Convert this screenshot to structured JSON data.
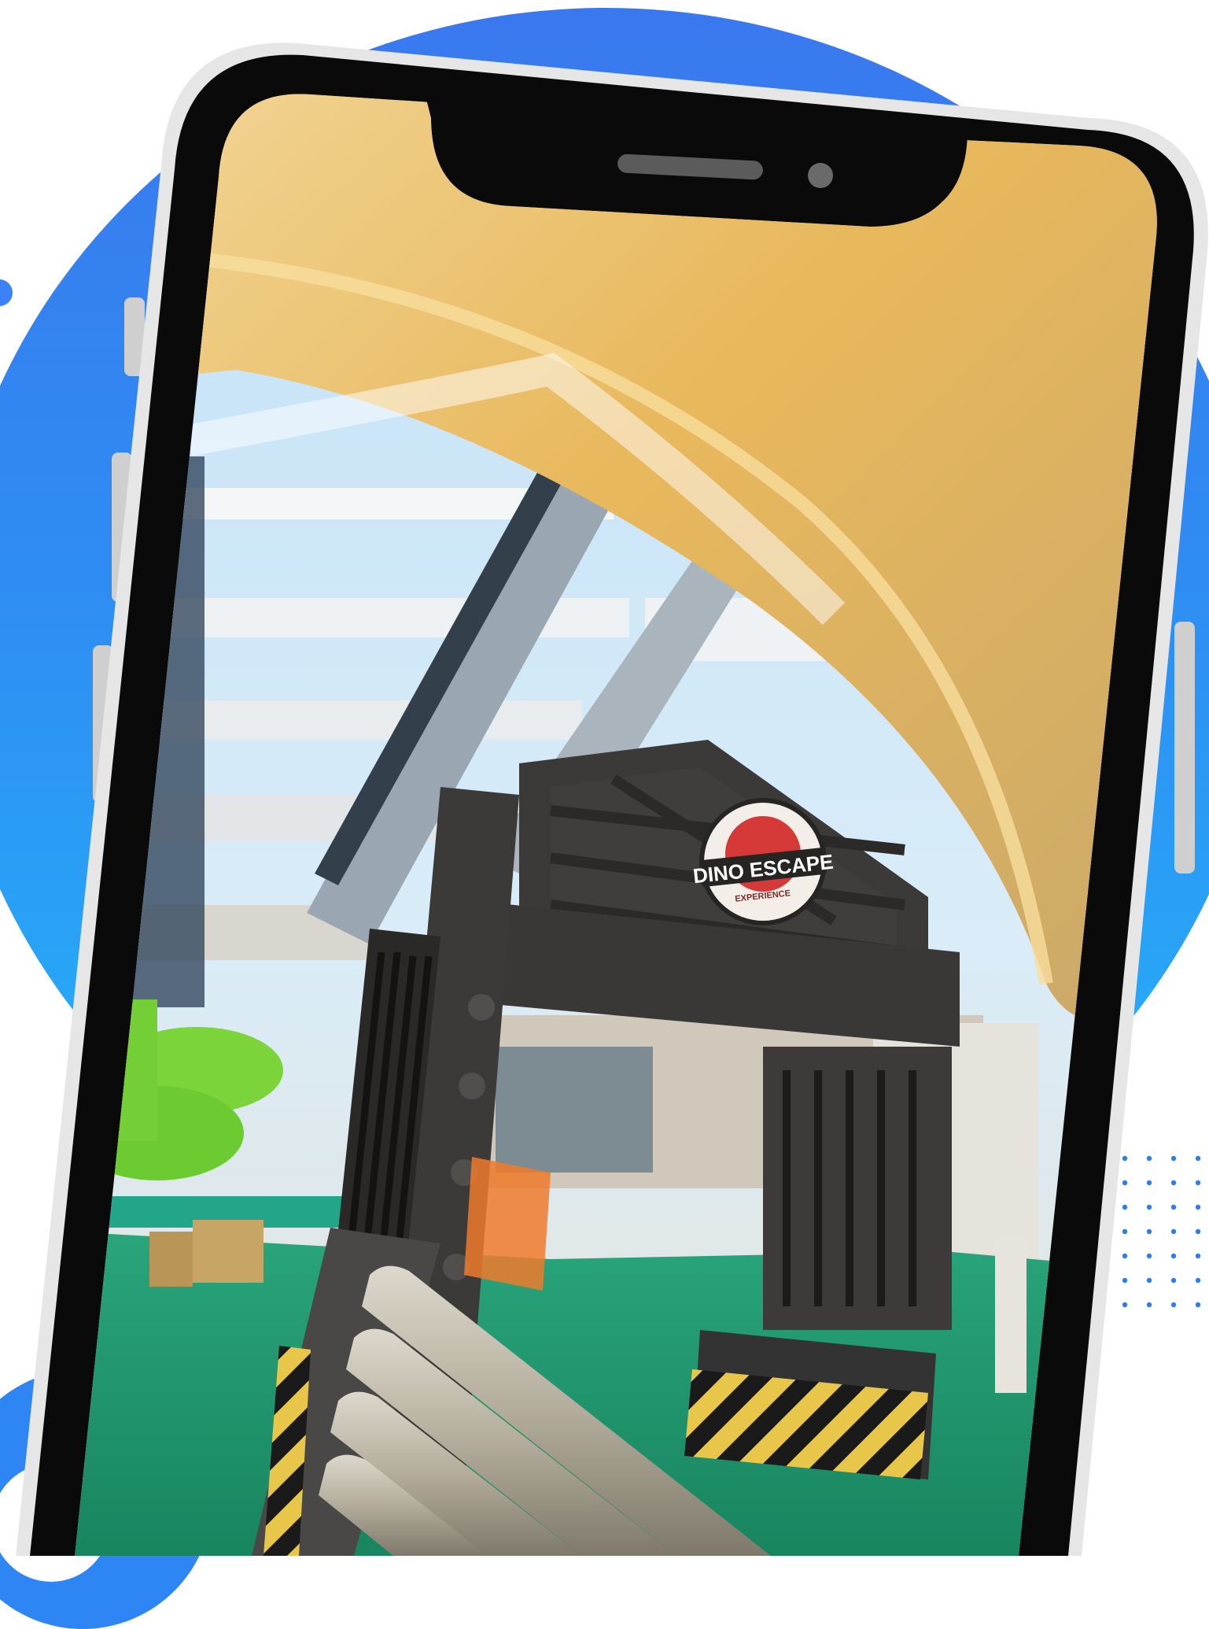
{
  "screen_sign": {
    "logo_text": "DINO ESCAPE",
    "logo_subtext": "EXPERIENCE"
  },
  "colors": {
    "background": "#ffffff",
    "circle_top": "#3a78ef",
    "circle_bottom": "#23b6fa",
    "phone_body": "#0a0a0a",
    "phone_rim": "#e6e6e6",
    "dot_pattern": "#2f7cf0",
    "turf": "#1f9a72",
    "ceiling": "#e8c070"
  },
  "icons": [
    "notch-speaker-icon",
    "notch-camera-icon"
  ]
}
